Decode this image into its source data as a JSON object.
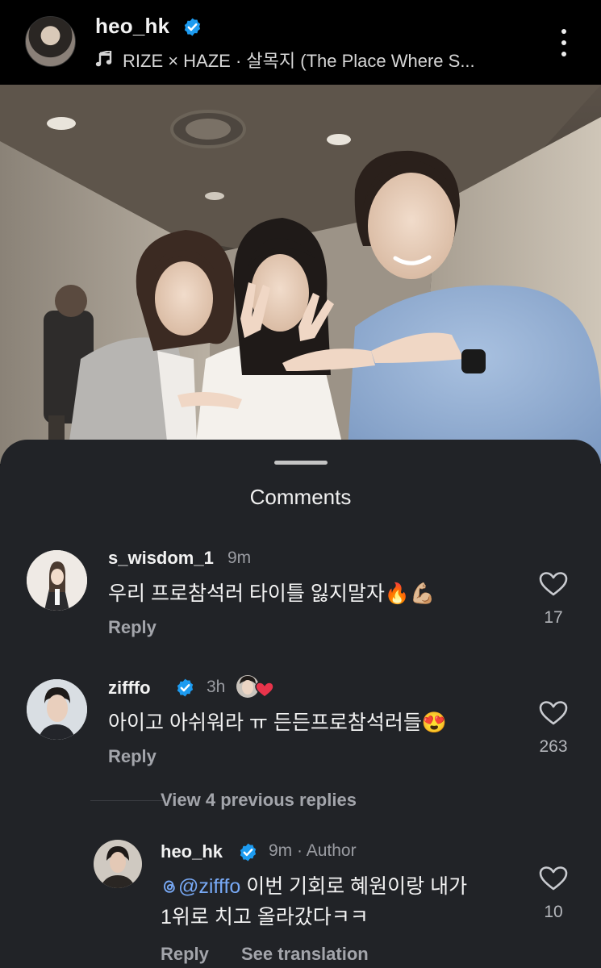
{
  "post": {
    "username": "heo_hk",
    "music_label": "RIZE × HAZE · 살목지 (The Place Where S..."
  },
  "sheet": {
    "title": "Comments"
  },
  "comments": [
    {
      "username": "s_wisdom_1",
      "time": "9m",
      "text": "우리 프로참석러 타이틀 잃지말자🔥💪🏼",
      "reply_label": "Reply",
      "likes": "17"
    },
    {
      "username": "zifffo",
      "time": "3h",
      "text": "아이고 아쉬워라 ㅠ 든든프로참석러들😍",
      "reply_label": "Reply",
      "likes": "263",
      "view_replies_label": "View 4 previous replies"
    }
  ],
  "reply": {
    "username": "heo_hk",
    "time": "9m",
    "author_label": "Author",
    "mention": "@zifffo",
    "text_line1": " 이번 기회로 혜원이랑 내가",
    "text_line2": "1위로 치고 올라갔다ㅋㅋ",
    "reply_label": "Reply",
    "translate_label": "See translation",
    "likes": "10"
  },
  "colors": {
    "verified_badge": "#1d9bf0",
    "like_heart": "#e8344b",
    "mention": "#78a9f5",
    "sheet_bg": "#212327"
  },
  "icons": [
    "music-note-icon",
    "more-vertical-icon",
    "verified-badge-icon",
    "heart-outline-icon",
    "threads-logo-icon"
  ]
}
